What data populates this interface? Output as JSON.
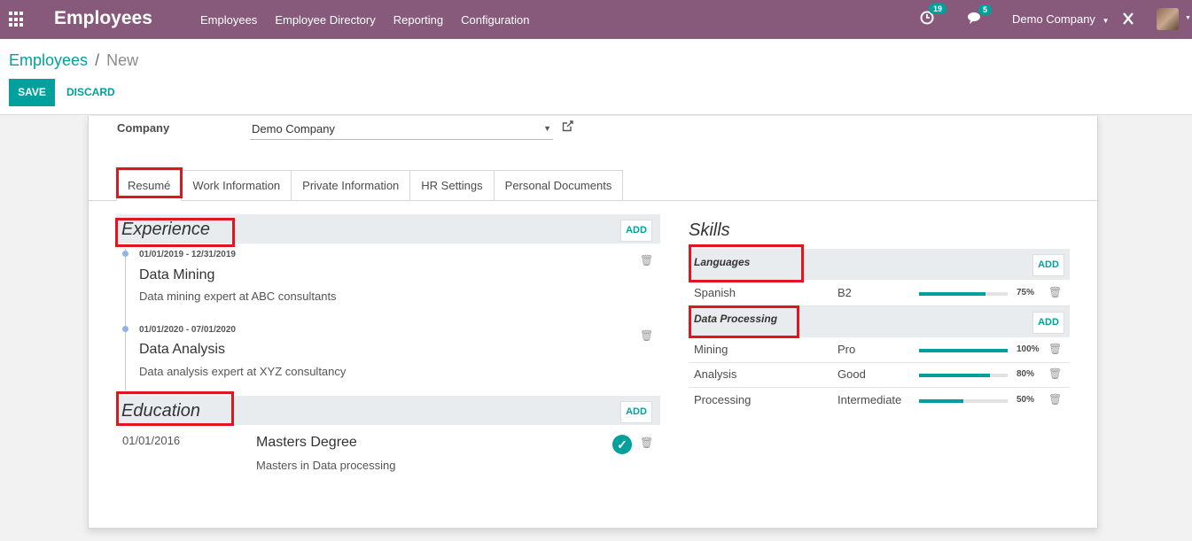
{
  "navbar": {
    "app_title": "Employees",
    "menu": [
      "Employees",
      "Employee Directory",
      "Reporting",
      "Configuration"
    ],
    "activity_count": "19",
    "message_count": "5",
    "company": "Demo Company"
  },
  "breadcrumb": {
    "parent": "Employees",
    "separator": "/",
    "current": "New"
  },
  "buttons": {
    "save": "SAVE",
    "discard": "DISCARD",
    "add": "ADD"
  },
  "form": {
    "company_label": "Company",
    "company_value": "Demo Company"
  },
  "tabs": [
    "Resumé",
    "Work Information",
    "Private Information",
    "HR Settings",
    "Personal Documents"
  ],
  "resume": {
    "experience_title": "Experience",
    "experience": [
      {
        "date": "01/01/2019 - 12/31/2019",
        "title": "Data Mining",
        "desc": "Data mining expert at ABC consultants"
      },
      {
        "date": "01/01/2020 - 07/01/2020",
        "title": "Data Analysis",
        "desc": "Data analysis expert at XYZ consultancy"
      }
    ],
    "education_title": "Education",
    "education": [
      {
        "date": "01/01/2016",
        "title": "Masters Degree",
        "desc": "Masters in Data processing"
      }
    ]
  },
  "skills": {
    "title": "Skills",
    "groups": [
      {
        "name": "Languages",
        "items": [
          {
            "name": "Spanish",
            "level": "B2",
            "progress": 75,
            "pct": "75%"
          }
        ]
      },
      {
        "name": "Data Processing",
        "items": [
          {
            "name": "Mining",
            "level": "Pro",
            "progress": 100,
            "pct": "100%"
          },
          {
            "name": "Analysis",
            "level": "Good",
            "progress": 80,
            "pct": "80%"
          },
          {
            "name": "Processing",
            "level": "Intermediate",
            "progress": 50,
            "pct": "50%"
          }
        ]
      }
    ]
  },
  "colors": {
    "brand": "#875a7b",
    "accent": "#00a09d",
    "highlight": "#e0151e"
  }
}
